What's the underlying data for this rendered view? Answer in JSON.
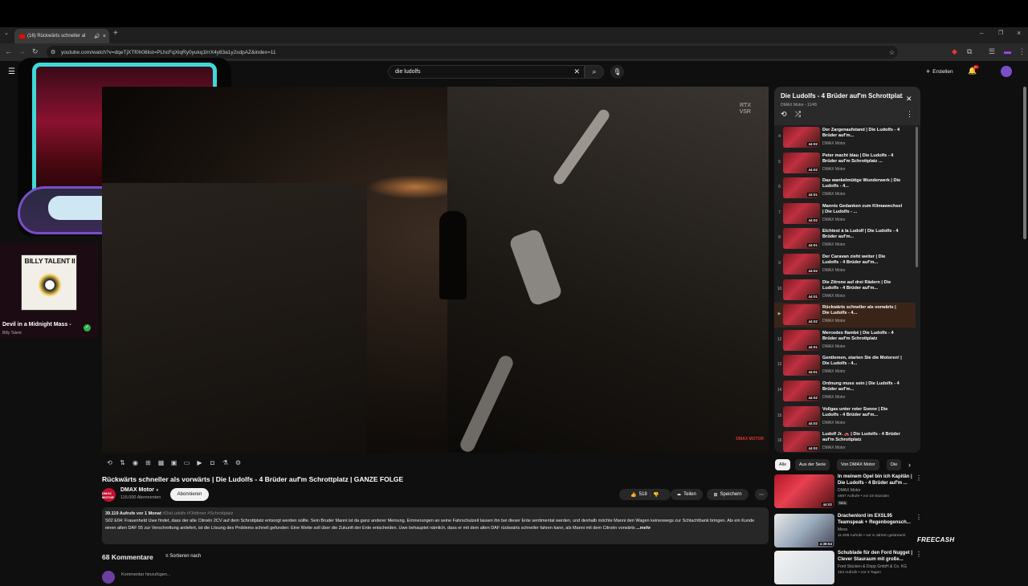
{
  "browser": {
    "tab_title": "(16) Rückwärts schneller al",
    "url": "youtube.com/watch?v=dqeTjXTf0h08list=PLhcFqXlqRy0yukq1lrrX4y83a1y2sdpAZ&index=11"
  },
  "youtube": {
    "search_value": "die ludolfs",
    "create_label": "Erstellen",
    "notif_count": "9+"
  },
  "music": {
    "album_text": "BILLY TALENT II",
    "title": "Devil in a Midnight Mass -",
    "artist": "Billy Talent"
  },
  "player": {
    "rtx_line1": "RTX",
    "rtx_line2": "VSR",
    "channel_bug": "DMAX MOTOR"
  },
  "video": {
    "title": "Rückwärts schneller als vorwärts | Die Ludolfs - 4 Brüder auf'm Schrottplatz | GANZE FOLGE",
    "channel": "DMAX Motor",
    "channel_avatar_text": "DMAX MOTOR",
    "subscribers": "115.000 Abonnenten",
    "subscribe_label": "Abonnieren",
    "likes": "518",
    "share_label": "Teilen",
    "save_label": "Speichern",
    "views_date": "39.119 Aufrufe  vor 1 Monat",
    "hashtags": "#DieLudolfs #Oldtimer #Schrottplatz",
    "description": "S02 E04: Frauenheld Uwe findet, dass der alte Citroën 2CV auf dem Schrottplatz entsorgt werden sollte. Sein Bruder Manni ist da ganz anderer Meinung. Erinnerungen an seine Fahrschulzeit lassen ihn bei dieser Ente sentimental werden, und deshalb möchte Manni den Wagen keineswegs zur Schlachtbank bringen. Als ein Kunde einen alten DAF 55 zur Verschrottung anliefert, ist die Lösung des Problems schnell gefunden: Eine Wette soll über die Zukunft der Ente entscheiden. Uwe behauptet nämlich, dass er mit dem alten DAF rückwärts schneller fahren kann, als Manni mit dem Citroën vorwärts",
    "more": " ...mehr",
    "comments_count": "68 Kommentare",
    "sort_label": "Sortieren nach",
    "add_comment": "Kommentar hinzufügen..."
  },
  "playlist": {
    "title": "Die Ludolfs - 4 Brüder auf'm Schrottplatz",
    "subtitle": "DMAX Motor - 11/45",
    "items": [
      {
        "num": "4",
        "title": "Der Zargenaufstand | Die Ludolfs - 4 Brüder auf'm...",
        "channel": "DMAX Motor",
        "duration": "44:02"
      },
      {
        "num": "5",
        "title": "Peter macht blau | Die Ludolfs - 4 Brüder auf'm Schrottplatz ...",
        "channel": "DMAX Motor",
        "duration": "44:02"
      },
      {
        "num": "6",
        "title": "Das wankelmütige Wunderwerk | Die Ludolfs - 4...",
        "channel": "DMAX Motor",
        "duration": "44:01"
      },
      {
        "num": "7",
        "title": "Mannis Gedanken zum Klimawechsel | Die Ludolfs - ...",
        "channel": "DMAX Motor",
        "duration": "44:02"
      },
      {
        "num": "8",
        "title": "Elchtest à la Ludolf | Die Ludolfs - 4 Brüder auf'm...",
        "channel": "DMAX Motor",
        "duration": "44:01"
      },
      {
        "num": "9",
        "title": "Der Caravan zieht weiter | Die Ludolfs - 4 Brüder auf'm...",
        "channel": "DMAX Motor",
        "duration": "44:02"
      },
      {
        "num": "10",
        "title": "Die Zitrone auf drei Rädern | Die Ludolfs - 4 Brüder auf'm...",
        "channel": "DMAX Motor",
        "duration": "44:01"
      },
      {
        "num": "▶",
        "title": "Rückwärts schneller als vorwärts | Die Ludolfs - 4...",
        "channel": "DMAX Motor",
        "duration": "44:02"
      },
      {
        "num": "12",
        "title": "Mercedes flambé | Die Ludolfs - 4 Brüder auf'm Schrottplatz",
        "channel": "DMAX Motor",
        "duration": "44:01"
      },
      {
        "num": "13",
        "title": "Gentlemen, starten Sie die Motoren! | Die Ludolfs - 4...",
        "channel": "DMAX Motor",
        "duration": "44:01"
      },
      {
        "num": "14",
        "title": "Ordnung muss sein | Die Ludolfs - 4 Brüder auf'm...",
        "channel": "DMAX Motor",
        "duration": "44:02"
      },
      {
        "num": "15",
        "title": "Vollgas unter roter Sonne | Die Ludolfs - 4 Brüder auf'm...",
        "channel": "DMAX Motor",
        "duration": "44:02"
      },
      {
        "num": "16",
        "title": "Ludolf Jr. 🚗 | Die Ludolfs - 4 Brüder auf'm Schrottplatz",
        "channel": "DMAX Motor",
        "duration": "44:02"
      }
    ]
  },
  "chips": [
    "Alle",
    "Aus der Serie",
    "Von DMAX Motor",
    "Die"
  ],
  "recommendations": [
    {
      "title": "In meinem Opel bin ich Kapitän | Die Ludolfs - 4 Brüder auf'm ...",
      "channel": "DMAX Motor",
      "meta": "4697 Aufrufe • vor 19 Stunden",
      "badge": "Neu",
      "duration": "44:02"
    },
    {
      "title": "Drachenlord im EXSL95 Teamspeak + Regenbogensch...",
      "channel": "Meso",
      "meta": "11.609 Aufrufe • vor 6 Jahren gestreamt",
      "badge": "",
      "duration": "4:38:54"
    },
    {
      "title": "Schublade für den Ford Nugget | Clever Stauraum mit große...",
      "channel": "Ford Stücken & Dopp GmbH & Co. KG",
      "meta": "153 Aufrufe • vor 3 Tagen",
      "badge": "",
      "duration": ""
    }
  ],
  "overlay": {
    "freecash": "FREECASH"
  }
}
